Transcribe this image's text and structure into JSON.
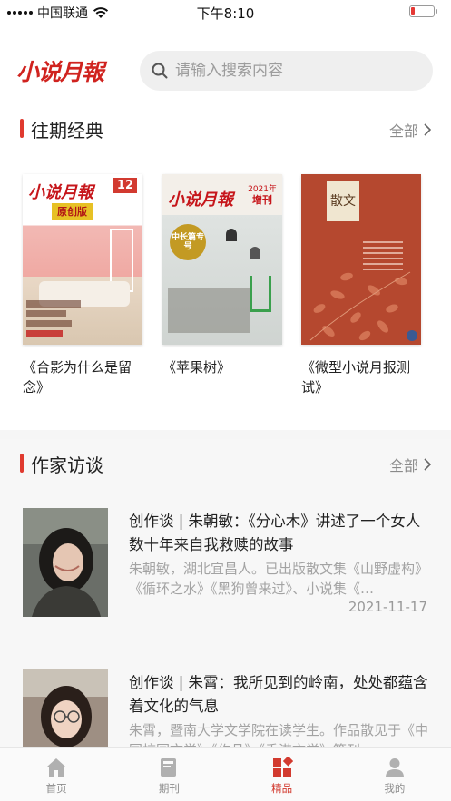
{
  "status_bar": {
    "carrier": "中国联通",
    "time": "下午8:10",
    "battery_level": 0.15
  },
  "header": {
    "logo_text": "小说月報",
    "search_placeholder": "请输入搜索内容"
  },
  "classics": {
    "title": "往期经典",
    "more_label": "全部",
    "books": [
      {
        "title": "《合影为什么是留念》",
        "cover": {
          "masthead": "小说月報",
          "issue": "12",
          "tag": "原创版"
        }
      },
      {
        "title": "《苹果树》",
        "cover": {
          "masthead": "小说月報",
          "year": "2021年",
          "issue_label": "增刊",
          "badge": "中长篇专号"
        }
      },
      {
        "title": "《微型小说月报测试》",
        "cover": {
          "masthead": "散文"
        }
      }
    ]
  },
  "interviews": {
    "title": "作家访谈",
    "more_label": "全部",
    "items": [
      {
        "title": "创作谈 | 朱朝敏：《分心木》讲述了一个女人数十年来自我救赎的故事",
        "summary": "朱朝敏，湖北宜昌人。已出版散文集《山野虚构》《循环之水》《黑狗曾来过》、小说集《…",
        "date": "2021-11-17"
      },
      {
        "title": "创作谈 | 朱霄：我所见到的岭南，处处都蕴含着文化的气息",
        "summary": "朱霄，暨南大学文学院在读学生。作品散见于《中国校园文学》《作品》《香港文学》等刊",
        "date": ""
      }
    ]
  },
  "tabbar": {
    "tabs": [
      {
        "label": "首页",
        "icon": "home-icon",
        "active": false
      },
      {
        "label": "期刊",
        "icon": "book-icon",
        "active": false
      },
      {
        "label": "精品",
        "icon": "diamond-grid-icon",
        "active": true
      },
      {
        "label": "我的",
        "icon": "person-icon",
        "active": false
      }
    ]
  },
  "colors": {
    "accent": "#d23a2f",
    "muted_text": "#a3a3a3",
    "search_bg": "#efefef"
  }
}
